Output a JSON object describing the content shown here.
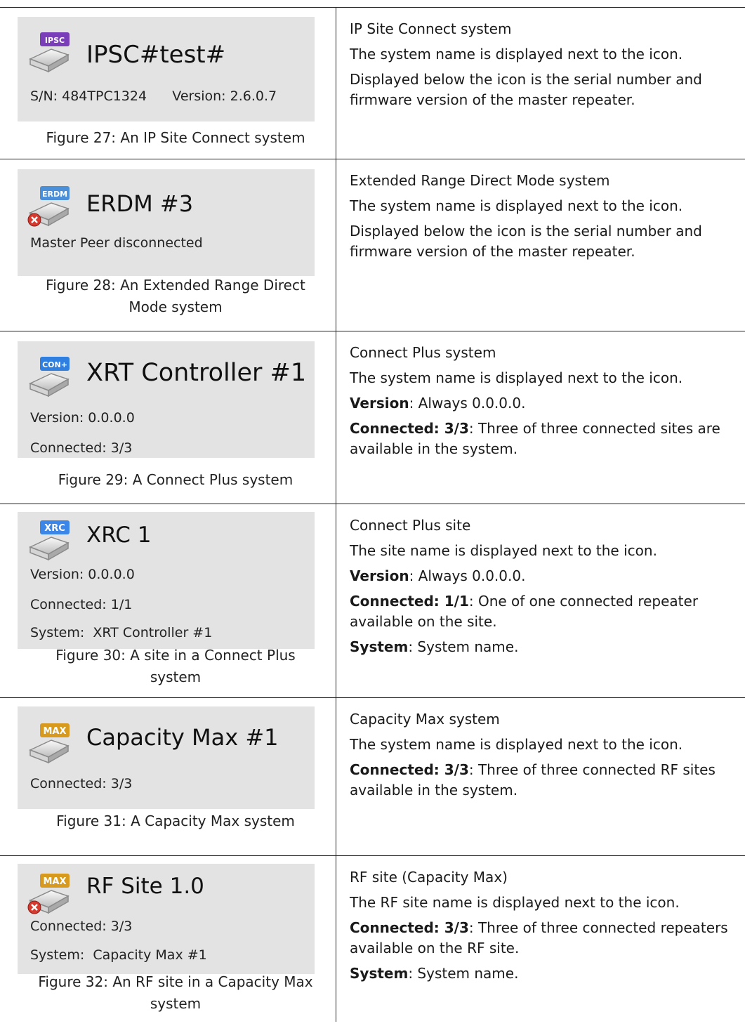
{
  "rows": [
    {
      "badge": "IPSC",
      "badge_color": "#7a3fb8",
      "error": false,
      "name": "IPSC#test#",
      "subs": [
        "S/N: 484TPC1324      Version: 2.6.0.7"
      ],
      "caption": "Figure 27: An IP Site Connect system",
      "desc": [
        {
          "bold": "",
          "text": "IP Site Connect system"
        },
        {
          "bold": "",
          "text": "The system name is displayed next to the icon."
        },
        {
          "bold": "",
          "text": "Displayed below the icon is the serial number and firmware version of the master repeater."
        }
      ]
    },
    {
      "badge": "ERDM",
      "badge_color": "#4a8fd8",
      "error": true,
      "name": "ERDM #3",
      "subs": [
        "Master Peer disconnected"
      ],
      "caption": "Figure 28: An Extended Range Direct Mode system",
      "desc": [
        {
          "bold": "",
          "text": "Extended Range Direct Mode system"
        },
        {
          "bold": "",
          "text": "The system name is displayed next to the icon."
        },
        {
          "bold": "",
          "text": "Displayed below the icon is the serial number and firmware version of the master repeater."
        }
      ]
    },
    {
      "badge": "CON+",
      "badge_color": "#2f7fe0",
      "error": false,
      "name": "XRT Controller #1",
      "subs": [
        "Version: 0.0.0.0",
        "Connected: 3/3"
      ],
      "caption": "Figure 29: A Connect Plus system",
      "desc": [
        {
          "bold": "",
          "text": "Connect Plus system"
        },
        {
          "bold": "",
          "text": "The system name is displayed next to the icon."
        },
        {
          "bold": "Version",
          "text": ": Always 0.0.0.0."
        },
        {
          "bold": "Connected: 3/3",
          "text": ": Three of three connected sites are available in the system."
        }
      ]
    },
    {
      "badge": "XRC",
      "badge_color": "#3b86e6",
      "error": false,
      "name": "XRC 1",
      "subs": [
        "Version: 0.0.0.0",
        "Connected: 1/1",
        "System:  XRT Controller #1"
      ],
      "caption": "Figure 30: A site in a Connect Plus system",
      "desc": [
        {
          "bold": "",
          "text": "Connect Plus site"
        },
        {
          "bold": "",
          "text": "The site name is displayed next to the icon."
        },
        {
          "bold": "Version",
          "text": ": Always 0.0.0.0."
        },
        {
          "bold": "Connected: 1/1",
          "text": ": One of one connected repeater available on the site."
        },
        {
          "bold": "System",
          "text": ": System name."
        }
      ]
    },
    {
      "badge": "MAX",
      "badge_color": "#d79a1e",
      "error": false,
      "name": "Capacity Max #1",
      "subs": [
        "Connected: 3/3"
      ],
      "caption": "Figure 31: A Capacity Max system",
      "desc": [
        {
          "bold": "",
          "text": "Capacity Max system"
        },
        {
          "bold": "",
          "text": "The system name is displayed next to the icon."
        },
        {
          "bold": "Connected: 3/3",
          "text": ": Three of three connected RF sites available in the system."
        }
      ]
    },
    {
      "badge": "MAX",
      "badge_color": "#d79a1e",
      "error": true,
      "name": "RF Site 1.0",
      "subs": [
        "Connected: 3/3",
        "System:  Capacity Max #1"
      ],
      "caption": "Figure 32: An RF site in a Capacity Max system",
      "desc": [
        {
          "bold": "",
          "text": "RF site (Capacity Max)"
        },
        {
          "bold": "",
          "text": "The RF site name is displayed next to the icon."
        },
        {
          "bold": "Connected: 3/3",
          "text": ": Three of three connected repeaters available on the RF site."
        },
        {
          "bold": "System",
          "text": ": System name."
        }
      ]
    }
  ]
}
